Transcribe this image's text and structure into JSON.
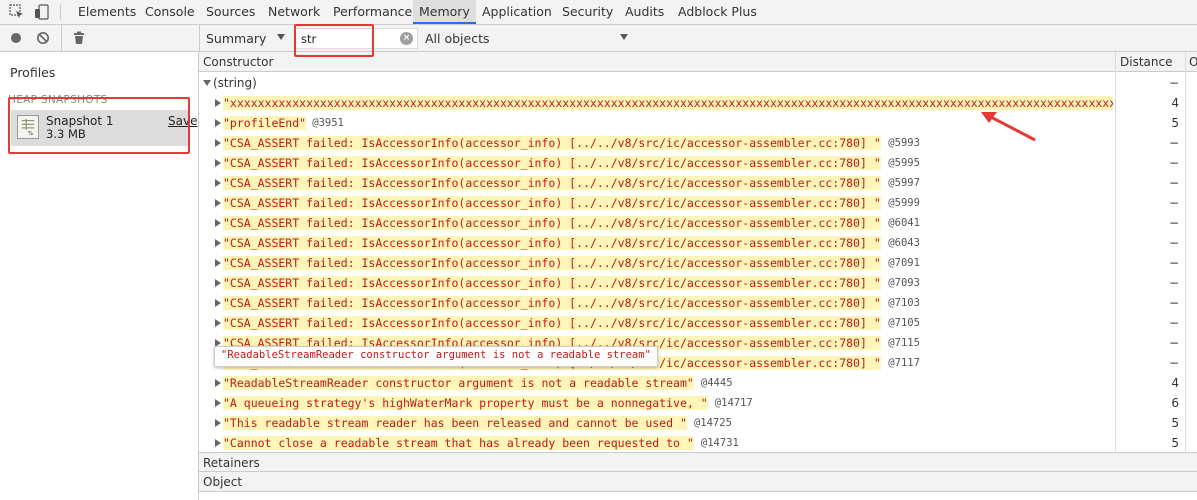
{
  "tabs": [
    "Elements",
    "Console",
    "Sources",
    "Network",
    "Performance",
    "Memory",
    "Application",
    "Security",
    "Audits",
    "Adblock Plus"
  ],
  "toolbar": {
    "view_select": "Summary",
    "filter_value": "str",
    "objects_select": "All objects"
  },
  "sidebar": {
    "profiles_title": "Profiles",
    "heap_title": "HEAP SNAPSHOTS",
    "snapshot_name": "Snapshot 1",
    "snapshot_size": "3.3 MB",
    "save_label": "Save"
  },
  "grid": {
    "col_constructor": "Constructor",
    "col_distance": "Distance",
    "col_extra": "O",
    "group": {
      "name": "(string)",
      "distance": "−"
    },
    "rows": [
      {
        "value": "\"xxxxxxxxxxxxxxxxxxxxxxxxxxxxxxxxxxxxxxxxxxxxxxxxxxxxxxxxxxxxxxxxxxxxxxxxxxxxxxxxxxxxxxxxxxxxxxxxxxxxxxxxxxxxxxxxxxxxxxxxxxxxxxxxxxxxxxxxxxxxxxxxxxxxxxxxxx",
        "id": "",
        "distance": "4"
      },
      {
        "value": "\"profileEnd\"",
        "id": "@3951",
        "distance": "5"
      },
      {
        "value": "\"CSA_ASSERT failed: IsAccessorInfo(accessor_info) [../../v8/src/ic/accessor-assembler.cc:780] \"",
        "id": "@5993",
        "distance": "−"
      },
      {
        "value": "\"CSA_ASSERT failed: IsAccessorInfo(accessor_info) [../../v8/src/ic/accessor-assembler.cc:780] \"",
        "id": "@5995",
        "distance": "−"
      },
      {
        "value": "\"CSA_ASSERT failed: IsAccessorInfo(accessor_info) [../../v8/src/ic/accessor-assembler.cc:780] \"",
        "id": "@5997",
        "distance": "−"
      },
      {
        "value": "\"CSA_ASSERT failed: IsAccessorInfo(accessor_info) [../../v8/src/ic/accessor-assembler.cc:780] \"",
        "id": "@5999",
        "distance": "−"
      },
      {
        "value": "\"CSA_ASSERT failed: IsAccessorInfo(accessor_info) [../../v8/src/ic/accessor-assembler.cc:780] \"",
        "id": "@6041",
        "distance": "−"
      },
      {
        "value": "\"CSA_ASSERT failed: IsAccessorInfo(accessor_info) [../../v8/src/ic/accessor-assembler.cc:780] \"",
        "id": "@6043",
        "distance": "−"
      },
      {
        "value": "\"CSA_ASSERT failed: IsAccessorInfo(accessor_info) [../../v8/src/ic/accessor-assembler.cc:780] \"",
        "id": "@7091",
        "distance": "−"
      },
      {
        "value": "\"CSA_ASSERT failed: IsAccessorInfo(accessor_info) [../../v8/src/ic/accessor-assembler.cc:780] \"",
        "id": "@7093",
        "distance": "−"
      },
      {
        "value": "\"CSA_ASSERT failed: IsAccessorInfo(accessor_info) [../../v8/src/ic/accessor-assembler.cc:780] \"",
        "id": "@7103",
        "distance": "−"
      },
      {
        "value": "\"CSA_ASSERT failed: IsAccessorInfo(accessor_info) [../../v8/src/ic/accessor-assembler.cc:780] \"",
        "id": "@7105",
        "distance": "−"
      },
      {
        "value": "\"CSA_ASSERT failed: IsAccessorInfo(accessor_info) [../../v8/src/ic/accessor-assembler.cc:780] \"",
        "id": "@7115",
        "distance": "−"
      },
      {
        "value": "\"CSA_ASSERT failed: IsAccessorInfo(accessor_info) [../../v8/src/ic/accessor-assembler.cc:780] \"",
        "id": "@7117",
        "distance": "−"
      },
      {
        "value": "\"ReadableStreamReader constructor argument is not a readable stream\"",
        "id": "@4445",
        "distance": "4"
      },
      {
        "value": "\"A queueing strategy's highWaterMark property must be a nonnegative, \"",
        "id": "@14717",
        "distance": "6"
      },
      {
        "value": "\"This readable stream reader has been released and cannot be used \"",
        "id": "@14725",
        "distance": "5"
      },
      {
        "value": "\"Cannot close a readable stream that has already been requested to \"",
        "id": "@14731",
        "distance": "5"
      }
    ],
    "tooltip": "\"ReadableStreamReader constructor argument is not a readable stream\""
  },
  "bottom": {
    "retainers": "Retainers",
    "object": "Object"
  },
  "colors": {
    "highlight_box": "#e53935",
    "string_value": "#c41a16",
    "string_bg": "#fff5b8"
  }
}
